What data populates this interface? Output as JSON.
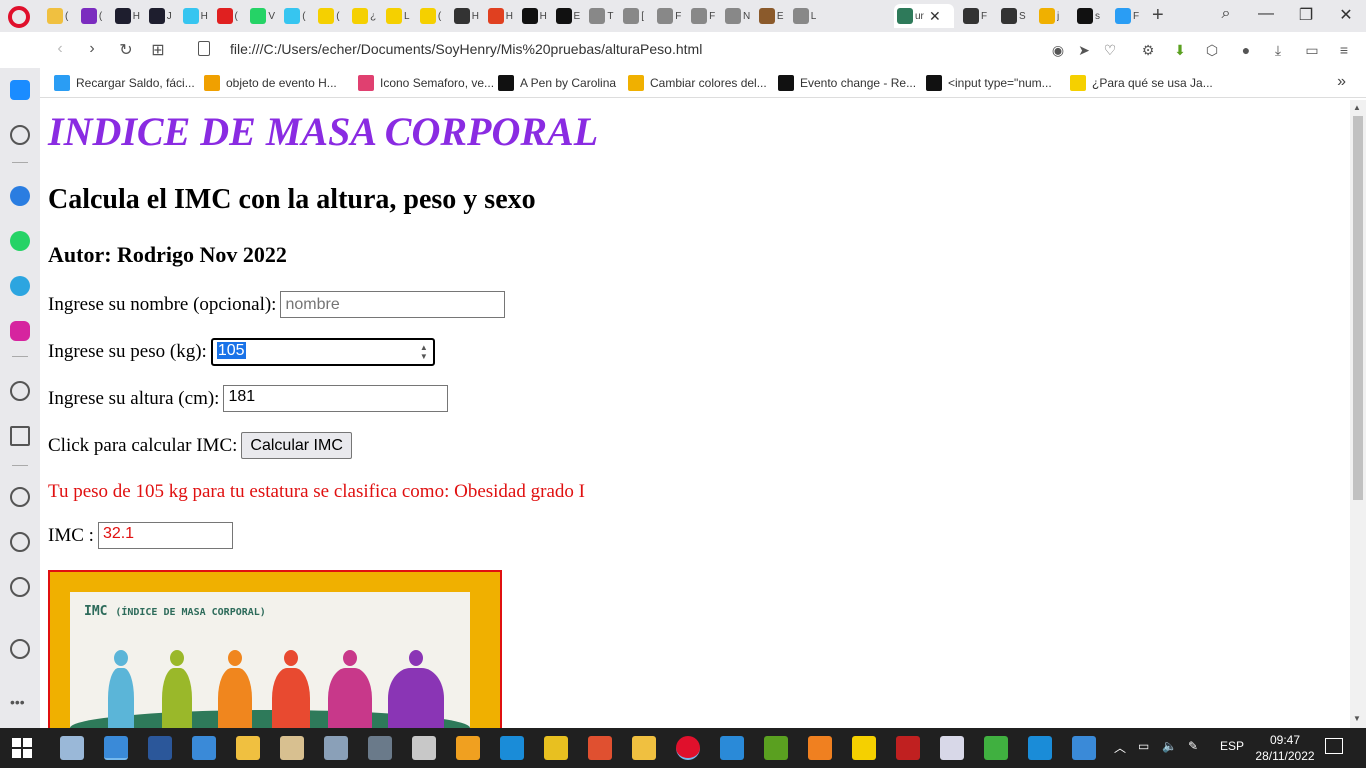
{
  "browser": {
    "active_tab_title": "ur",
    "url": "file:///C:/Users/echer/Documents/SoyHenry/Mis%20pruebas/alturaPeso.html",
    "tabs": [
      {
        "title": "(",
        "color": "#f0c040"
      },
      {
        "title": "(",
        "color": "#7b2cbf"
      },
      {
        "title": "H",
        "color": "#1e1e2e"
      },
      {
        "title": "J",
        "color": "#1e1e2e"
      },
      {
        "title": "H",
        "color": "#36c5f0"
      },
      {
        "title": "(",
        "color": "#e02020"
      },
      {
        "title": "V",
        "color": "#25d366"
      },
      {
        "title": "(",
        "color": "#36c5f0"
      },
      {
        "title": "(",
        "color": "#f5d000"
      },
      {
        "title": "¿",
        "color": "#f5d000"
      },
      {
        "title": "L",
        "color": "#f5d000"
      },
      {
        "title": "(",
        "color": "#f5d000"
      },
      {
        "title": "H",
        "color": "#333333"
      },
      {
        "title": "H",
        "color": "#e04020"
      },
      {
        "title": "H",
        "color": "#111111"
      },
      {
        "title": "E",
        "color": "#111111"
      },
      {
        "title": "T",
        "color": "#888888"
      },
      {
        "title": "[",
        "color": "#888888"
      },
      {
        "title": "F",
        "color": "#888888"
      },
      {
        "title": "F",
        "color": "#888888"
      },
      {
        "title": "N",
        "color": "#888888"
      },
      {
        "title": "E",
        "color": "#8b5a2b"
      },
      {
        "title": "L",
        "color": "#888888"
      }
    ],
    "tabs_after": [
      {
        "title": "F",
        "color": "#333333"
      },
      {
        "title": "S",
        "color": "#333333"
      },
      {
        "title": "j",
        "color": "#f0b000"
      },
      {
        "title": "s",
        "color": "#111111"
      },
      {
        "title": "F",
        "color": "#2a9df4"
      }
    ],
    "bookmarks": [
      {
        "label": "Recargar Saldo, fáci...",
        "color": "#2a9df4"
      },
      {
        "label": "objeto de evento H...",
        "color": "#f0a000"
      },
      {
        "label": "Icono Semaforo, ve...",
        "color": "#e04070"
      },
      {
        "label": "A Pen by Carolina",
        "color": "#111111"
      },
      {
        "label": "Cambiar colores del...",
        "color": "#f0b000"
      },
      {
        "label": "Evento change - Re...",
        "color": "#111111"
      },
      {
        "label": "<input type=\"num...",
        "color": "#111111"
      },
      {
        "label": "¿Para qué se usa Ja...",
        "color": "#f5d000"
      }
    ]
  },
  "page": {
    "title": "INDICE DE MASA CORPORAL",
    "subtitle": "Calcula el IMC con la altura, peso y sexo",
    "author": "Autor: Rodrigo Nov 2022",
    "name_label": "Ingrese su nombre (opcional):",
    "name_placeholder": "nombre",
    "weight_label": "Ingrese su peso (kg):",
    "weight_value": "105",
    "height_label": "Ingrese su altura (cm):",
    "height_value": "181",
    "calc_label": "Click para calcular IMC:",
    "calc_button": "Calcular IMC",
    "result_text": "Tu peso de 105 kg para tu estatura se clasifica como: Obesidad grado I",
    "imc_label": "IMC :",
    "imc_value": "32.1",
    "poster": {
      "title": "IMC",
      "subtitle": "(ÍNDICE DE MASA CORPORAL)",
      "figure_colors": [
        "#5bb5d8",
        "#9ab82a",
        "#f0861e",
        "#e84a30",
        "#c8388a",
        "#8a35b5"
      ]
    }
  },
  "taskbar": {
    "language": "ESP",
    "time": "09:47",
    "date": "28/11/2022"
  }
}
